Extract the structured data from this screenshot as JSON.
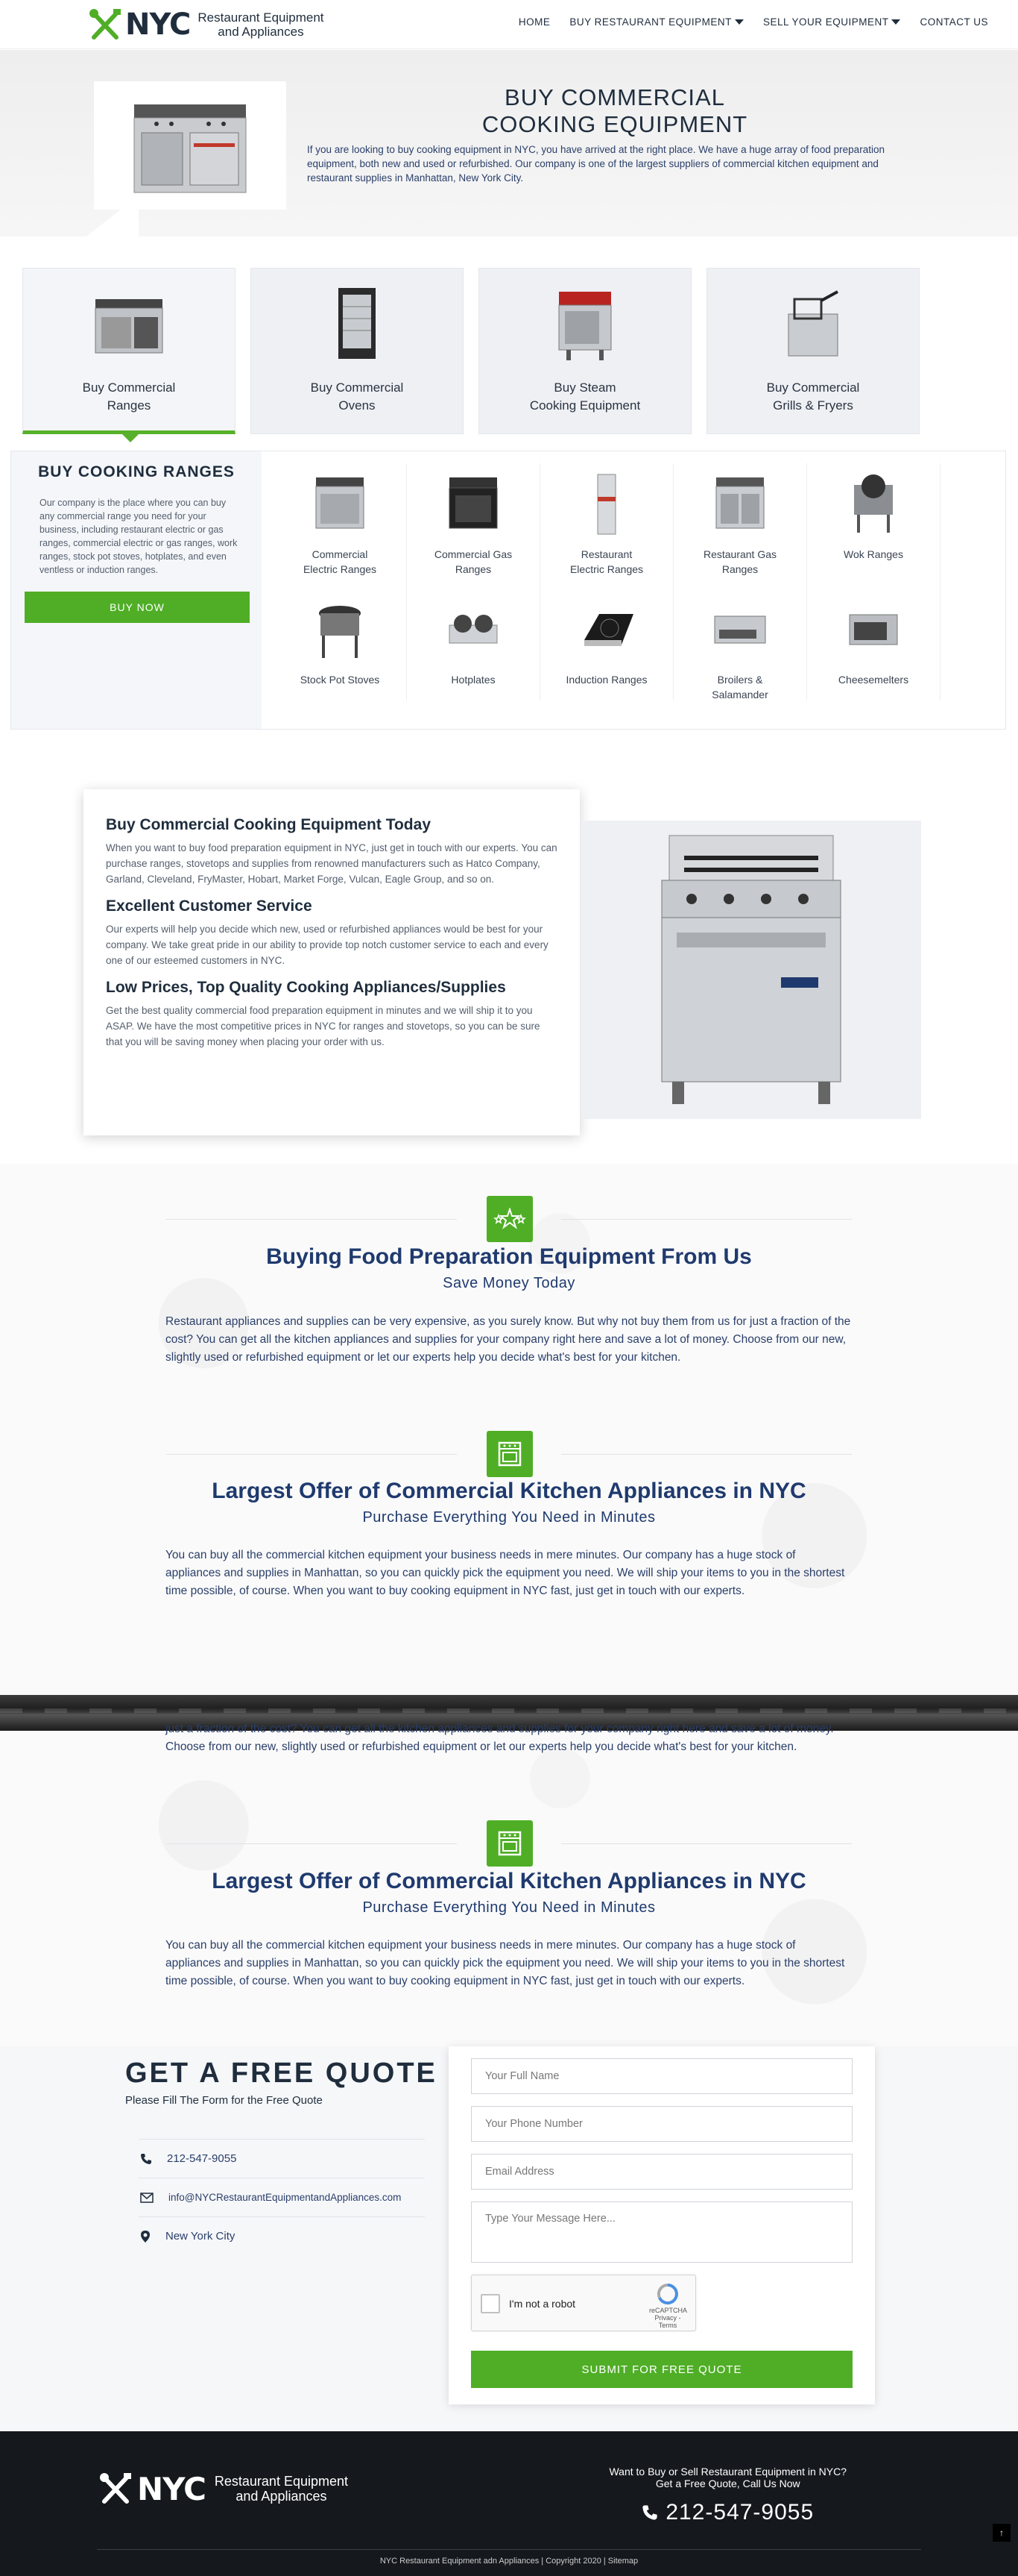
{
  "header": {
    "logo_text": "NYC",
    "logo_sub_line1": "Restaurant Equipment",
    "logo_sub_line2": "and Appliances",
    "nav": [
      {
        "label": "HOME"
      },
      {
        "label": "BUY RESTAURANT EQUIPMENT"
      },
      {
        "label": "SELL YOUR EQUIPMENT"
      },
      {
        "label": "CONTACT US"
      }
    ]
  },
  "hero": {
    "title_line1": "BUY COMMERCIAL",
    "title_line2": "COOKING EQUIPMENT",
    "text": "If you are looking to buy cooking equipment in NYC, you have arrived at the right place. We have a huge array of food preparation equipment, both new and used or refurbished. Our company is one of the largest suppliers of commercial kitchen equipment and restaurant supplies in Manhattan, New York City."
  },
  "tabs": [
    {
      "line1": "Buy Commercial",
      "line2": "Ranges"
    },
    {
      "line1": "Buy Commercial",
      "line2": "Ovens"
    },
    {
      "line1": "Buy Steam",
      "line2": "Cooking Equipment"
    },
    {
      "line1": "Buy Commercial",
      "line2": "Grills & Fryers"
    }
  ],
  "ranges_panel": {
    "title": "BUY COOKING RANGES",
    "text": "Our company is the place where you can buy any commercial range you need for your business, including restaurant electric or gas ranges, commercial electric or gas ranges, work ranges, stock pot stoves, hotplates, and even ventless or induction ranges.",
    "button": "BUY NOW",
    "items": [
      {
        "label": "Commercial Electric Ranges"
      },
      {
        "label": "Commercial Gas Ranges"
      },
      {
        "label": "Restaurant Electric Ranges"
      },
      {
        "label": "Restaurant Gas Ranges"
      },
      {
        "label": "Wok Ranges"
      },
      {
        "label": "Stock Pot Stoves"
      },
      {
        "label": "Hotplates"
      },
      {
        "label": "Induction Ranges"
      },
      {
        "label": "Broilers & Salamander"
      },
      {
        "label": "Cheesemelters"
      }
    ]
  },
  "info": {
    "h1": "Buy Commercial Cooking Equipment Today",
    "p1": "When you want to buy food preparation equipment in NYC, just get in touch with our experts. You can purchase ranges, stovetops and supplies from renowned manufacturers such as Hatco Company, Garland, Cleveland, FryMaster, Hobart, Market Forge, Vulcan, Eagle Group, and so on.",
    "h2": "Excellent Customer Service",
    "p2": "Our experts will help you decide which new, used or refurbished appliances would be best for your company. We take great pride in our ability to provide top notch customer service to each and every one of our esteemed customers in NYC.",
    "h3": "Low Prices, Top Quality Cooking Appliances/Supplies",
    "p3": "Get the best quality commercial food preparation equipment in minutes and we will ship it to you ASAP. We have the most competitive prices in NYC for ranges and stovetops, so you can be sure that you will be saving money when placing your order with us."
  },
  "section1": {
    "title": "Buying Food Preparation Equipment From Us",
    "subtitle": "Save Money Today",
    "text": "Restaurant appliances and supplies can be very expensive, as you surely know. But why not buy them from us for just a fraction of the cost? You can get all the kitchen appliances and supplies for your company right here and save a lot of money. Choose from our new, slightly used or refurbished equipment or let our experts help you decide what's best for your kitchen."
  },
  "section2": {
    "title": "Largest Offer of Commercial Kitchen Appliances in NYC",
    "subtitle": "Purchase Everything You Need in Minutes",
    "text": "You can buy all the commercial kitchen equipment your business needs in mere minutes. Our company has a huge stock of appliances and supplies in Manhattan, so you can quickly pick the equipment you need. We will ship your items to you in the shortest time possible, of course. When you want to buy cooking equipment in NYC fast, just get in touch with our experts."
  },
  "repeat": {
    "partial_text": "just a fraction of the cost? You can get all the kitchen appliances and supplies for your company right here and save a lot of money. Choose from our new, slightly used or refurbished equipment or let our experts help you decide what's best for your kitchen."
  },
  "quote": {
    "title": "GET A FREE QUOTE",
    "subtitle": "Please Fill The Form for the Free Quote",
    "phone": "212-547-9055",
    "email": "info@NYCRestaurantEquipmentandAppliances.com",
    "location": "New York City",
    "name_placeholder": "Your Full Name",
    "phone_placeholder": "Your Phone Number",
    "email_placeholder": "Email Address",
    "message_placeholder": "Type Your Message Here...",
    "captcha_label": "I'm not a robot",
    "captcha_brand": "reCAPTCHA",
    "captcha_links": "Privacy - Terms",
    "submit": "SUBMIT FOR FREE QUOTE"
  },
  "footer": {
    "logo_text": "NYC",
    "logo_sub_line1": "Restaurant Equipment",
    "logo_sub_line2": "and Appliances",
    "question": "Want to Buy or Sell Restaurant Equipment in NYC?",
    "cta": "Get a Free Quote, Call Us Now",
    "phone": "212-547-9055",
    "copyright": "NYC Restaurant Equipment adn Appliances | Copyright 2020 | Sitemap",
    "to_top": "↑"
  },
  "colors": {
    "accent": "#4fae26",
    "navy": "#1f3a6e",
    "dark": "#15191e"
  }
}
